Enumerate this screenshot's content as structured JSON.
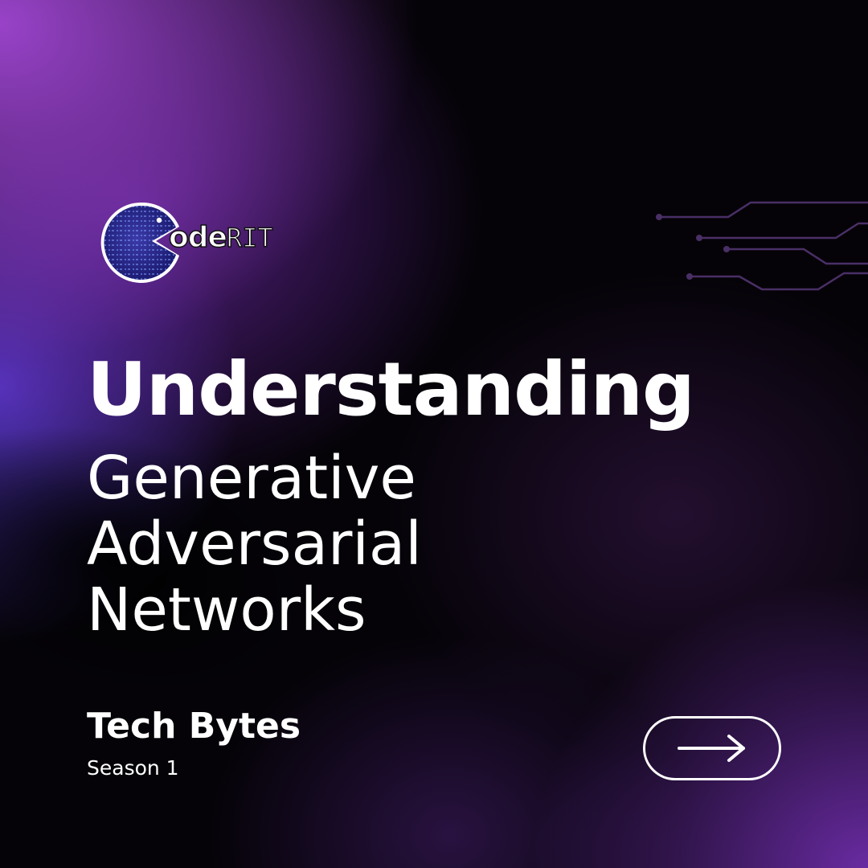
{
  "logo": {
    "word": "ode",
    "suffix": "RIT",
    "icon": "coderit-logo-icon"
  },
  "decoration": {
    "icon": "circuit-lines-icon",
    "color": "#4a2f66"
  },
  "title": {
    "main": "Understanding",
    "lines": [
      "Generative",
      "Adversarial",
      "Networks"
    ]
  },
  "series": {
    "name": "Tech Bytes",
    "season": "Season 1"
  },
  "navigation": {
    "icon": "arrow-right-icon"
  },
  "colors": {
    "text": "#ffffff",
    "accent_purple": "#8a3fd1",
    "accent_blue": "#5a3bd0",
    "background": "#050308"
  }
}
